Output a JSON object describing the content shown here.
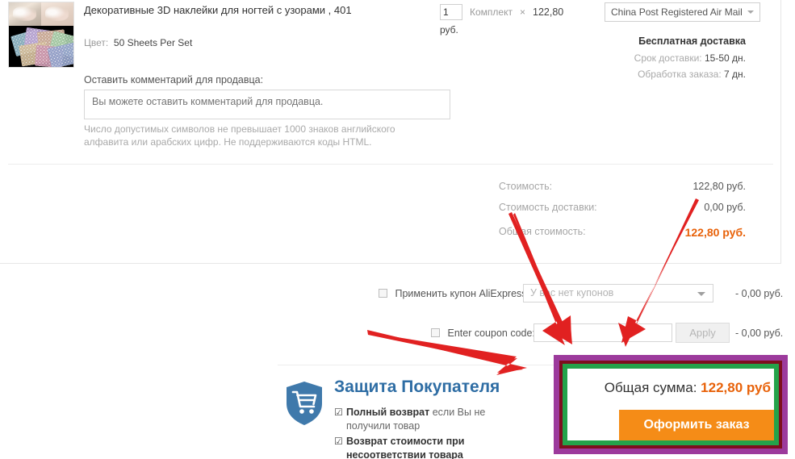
{
  "product": {
    "title": "Декоративные 3D наклейки для ногтей с узорами , 401",
    "attr_label": "Цвет:",
    "attr_value": "50 Sheets Per Set",
    "thumbnail_icon": "product-thumbnail"
  },
  "comment": {
    "label": "Оставить комментарий для продавца:",
    "placeholder": "Вы можете оставить комментарий для продавца.",
    "value": "",
    "hint": "Число допустимых символов не превышает 1000 знаков английского алфавита или арабских цифр. Не поддерживаются коды HTML."
  },
  "quantity": {
    "value": "1",
    "unit": "Комплект",
    "multiply_sign": "×",
    "unit_price": "122,80",
    "currency": "руб."
  },
  "shipping": {
    "method": "China Post Registered Air Mail",
    "caret_icon": "chevron-down-icon",
    "free_label": "Бесплатная доставка",
    "delivery_time_label": "Срок доставки:",
    "delivery_time_value": "15-50 дн.",
    "processing_label": "Обработка заказа:",
    "processing_value": "7 дн."
  },
  "totals": {
    "rows": [
      {
        "label": "Стоимость:",
        "value": "122,80 руб."
      },
      {
        "label": "Стоимость доставки:",
        "value": "0,00 руб."
      },
      {
        "label": "Общая стоимость:",
        "value": "122,80 руб."
      }
    ]
  },
  "coupons": {
    "aliexpress": {
      "label": "Применить купон AliExpress:",
      "select_placeholder": "У вас нет купонов",
      "caret_icon": "chevron-down-icon",
      "amount": "- 0,00 руб.",
      "checked": false
    },
    "code": {
      "label": "Enter coupon code:",
      "input_value": "",
      "apply_label": "Apply",
      "amount": "- 0,00 руб.",
      "checked": false
    }
  },
  "buyer_protection": {
    "shield_icon": "shield-cart-icon",
    "title": "Защита Покупателя",
    "items": [
      {
        "check_icon": "check-box-icon",
        "strong": "Полный возврат",
        "rest": " если Вы не получили товар"
      },
      {
        "check_icon": "check-box-icon",
        "strong": "Возврат стоимости при",
        "rest": " несоответствии товара"
      }
    ]
  },
  "checkout": {
    "total_label": "Общая сумма:",
    "total_value": "122,80 руб",
    "button_label": "Оформить заказ",
    "highlight_colors": {
      "outer": "#9c3a9c",
      "middle": "#7e0f1e",
      "inner": "#24a34a",
      "button": "#f58c17",
      "amount": "#e8620a"
    }
  },
  "annotations": {
    "arrow_color": "#e12121",
    "arrows": [
      {
        "name": "arrow-to-coupon-code-input"
      },
      {
        "name": "arrow-to-apply-area"
      },
      {
        "name": "arrow-to-checkout-box"
      }
    ]
  }
}
